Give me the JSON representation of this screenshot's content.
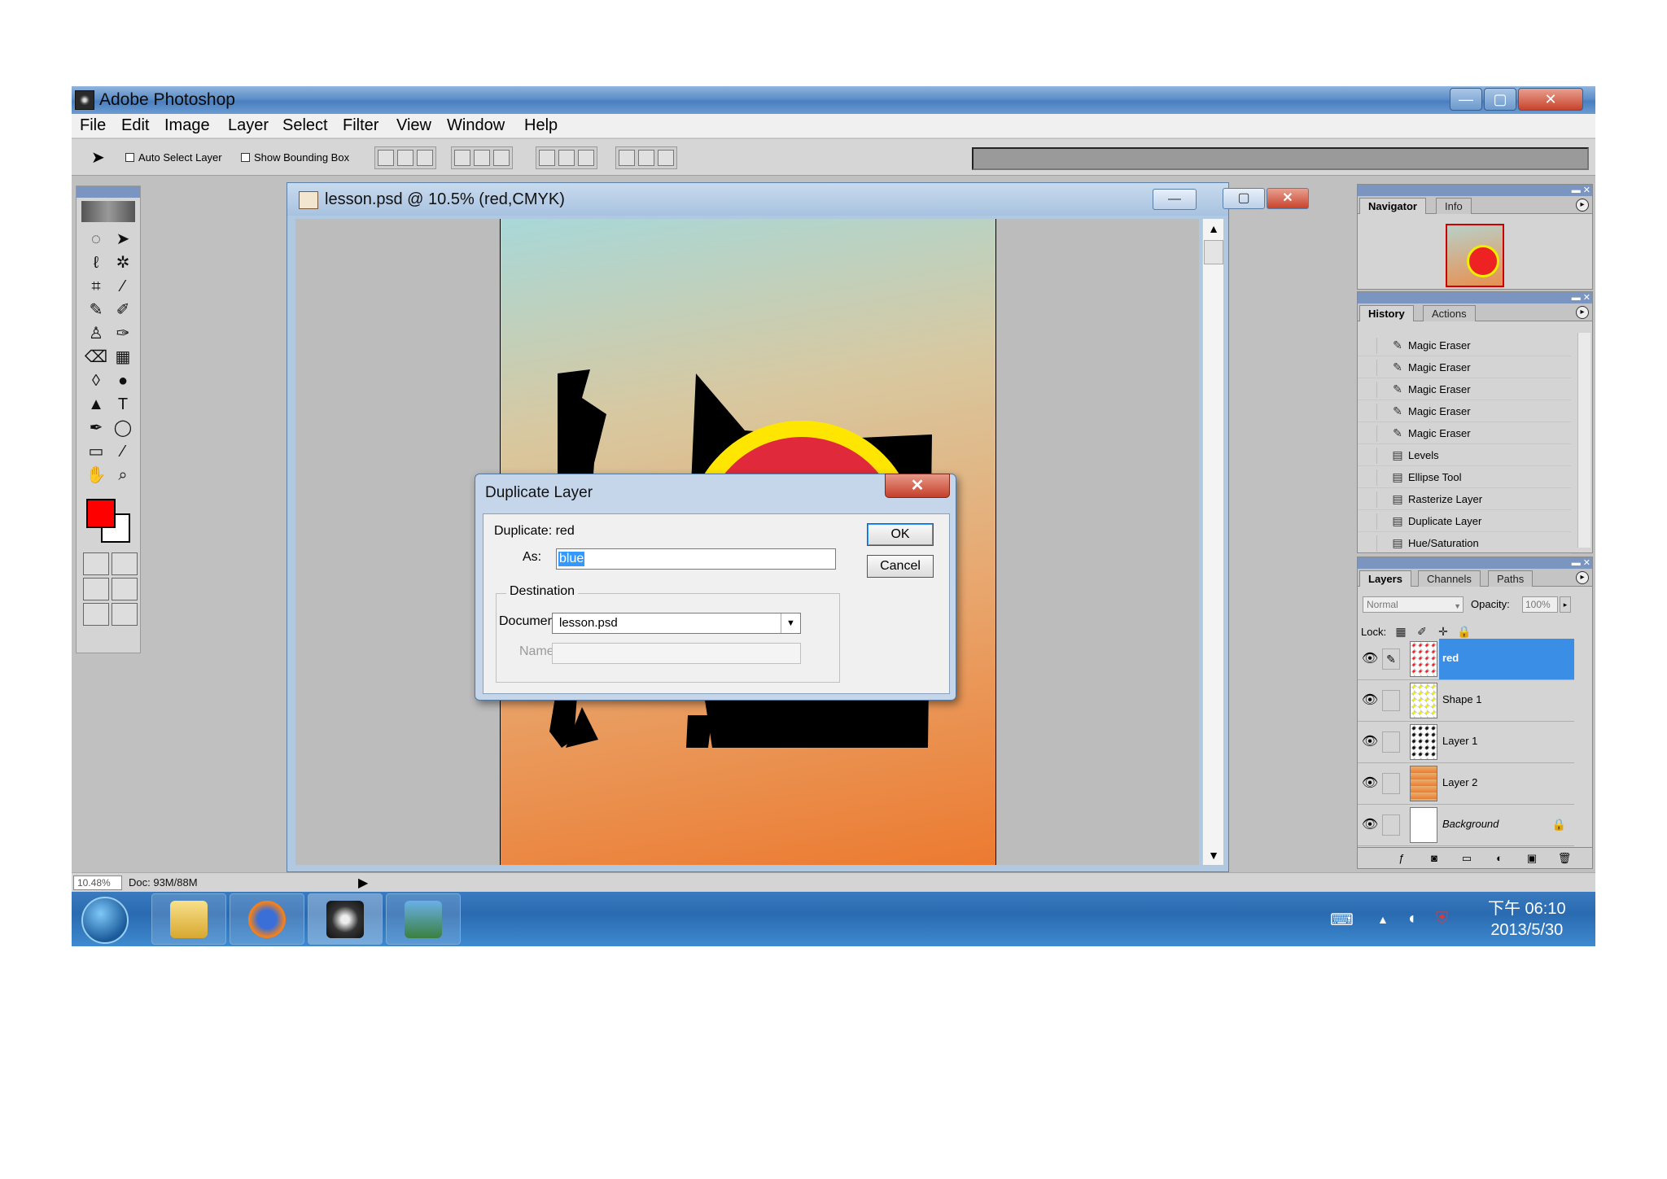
{
  "window": {
    "title": "Adobe Photoshop",
    "minimize": "—",
    "maximize": "▢",
    "close": "✕"
  },
  "menu": [
    "File",
    "Edit",
    "Image",
    "Layer",
    "Select",
    "Filter",
    "View",
    "Window",
    "Help"
  ],
  "options": {
    "auto_select_layer": "Auto Select Layer",
    "show_bounding_box": "Show Bounding Box"
  },
  "document": {
    "title": "lesson.psd @ 10.5% (red,CMYK)",
    "minimize": "—",
    "maximize": "▢",
    "close": "✕"
  },
  "status": {
    "zoom": "10.48%",
    "doc_size": "Doc: 93M/88M",
    "arrow": "▶"
  },
  "toolbox": {
    "foreground_color": "#ff0000",
    "background_color": "#ffffff"
  },
  "navigator_panel": {
    "tabs": [
      "Navigator",
      "Info"
    ]
  },
  "history_panel": {
    "tabs": [
      "History",
      "Actions"
    ],
    "items": [
      {
        "label": "Magic Eraser",
        "icon": "magic-eraser-icon"
      },
      {
        "label": "Magic Eraser",
        "icon": "magic-eraser-icon"
      },
      {
        "label": "Magic Eraser",
        "icon": "magic-eraser-icon"
      },
      {
        "label": "Magic Eraser",
        "icon": "magic-eraser-icon"
      },
      {
        "label": "Magic Eraser",
        "icon": "magic-eraser-icon"
      },
      {
        "label": "Levels",
        "icon": "document-icon"
      },
      {
        "label": "Ellipse Tool",
        "icon": "document-icon"
      },
      {
        "label": "Rasterize Layer",
        "icon": "document-icon"
      },
      {
        "label": "Duplicate Layer",
        "icon": "document-icon"
      },
      {
        "label": "Hue/Saturation",
        "icon": "document-icon"
      }
    ]
  },
  "layers_panel": {
    "tabs": [
      "Layers",
      "Channels",
      "Paths"
    ],
    "blend_mode": "Normal",
    "opacity_label": "Opacity:",
    "opacity_value": "100%",
    "lock_label": "Lock:",
    "layers": [
      {
        "name": "red",
        "selected": true,
        "italic": false,
        "locked": false
      },
      {
        "name": "Shape 1",
        "selected": false,
        "italic": false,
        "locked": false
      },
      {
        "name": "Layer 1",
        "selected": false,
        "italic": false,
        "locked": false
      },
      {
        "name": "Layer 2",
        "selected": false,
        "italic": false,
        "locked": false
      },
      {
        "name": "Background",
        "selected": false,
        "italic": true,
        "locked": true
      }
    ]
  },
  "dialog": {
    "title": "Duplicate Layer",
    "close": "✕",
    "duplicate_label": "Duplicate: red",
    "as_label": "As:",
    "as_value": "blue",
    "ok": "OK",
    "cancel": "Cancel",
    "destination_legend": "Destination",
    "document_label": "Document:",
    "document_value": "lesson.psd",
    "name_label": "Name:"
  },
  "taskbar": {
    "time": "下午 06:10",
    "date": "2013/5/30",
    "apps": [
      "explorer",
      "firefox",
      "photoshop",
      "photo-viewer"
    ]
  }
}
